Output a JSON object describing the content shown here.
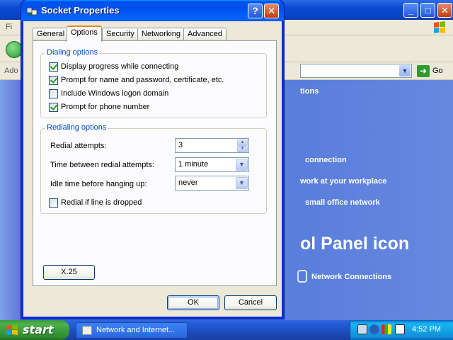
{
  "background_window": {
    "menu_partial": "Fi",
    "address_label_partial": "Ado",
    "go_label": "Go",
    "content": {
      "line1": "tions",
      "line2": "connection",
      "line3": "work at your workplace",
      "line4": "small office network",
      "heading": "ol Panel icon",
      "line6": "Network Connections"
    }
  },
  "dialog": {
    "title": "Socket Properties",
    "help_glyph": "?",
    "close_glyph": "✕",
    "tabs": [
      {
        "label": "General",
        "active": false
      },
      {
        "label": "Options",
        "active": true
      },
      {
        "label": "Security",
        "active": false
      },
      {
        "label": "Networking",
        "active": false
      },
      {
        "label": "Advanced",
        "active": false
      }
    ],
    "dialing_options": {
      "title": "Dialing options",
      "items": [
        {
          "label": "Display progress while connecting",
          "checked": true
        },
        {
          "label": "Prompt for name and password, certificate, etc.",
          "checked": true
        },
        {
          "label": "Include Windows logon domain",
          "checked": false
        },
        {
          "label": "Prompt for phone number",
          "checked": true
        }
      ]
    },
    "redialing_options": {
      "title": "Redialing options",
      "redial_attempts_label": "Redial attempts:",
      "redial_attempts_value": "3",
      "time_between_label": "Time between redial attempts:",
      "time_between_value": "1 minute",
      "idle_time_label": "Idle time before hanging up:",
      "idle_time_value": "never",
      "redial_if_dropped_label": "Redial if line is dropped",
      "redial_if_dropped_checked": false
    },
    "x25_button": "X.25",
    "ok_button": "OK",
    "cancel_button": "Cancel"
  },
  "taskbar": {
    "start_label": "start",
    "task_item": "Network and Internet...",
    "clock": "4:52 PM"
  },
  "colors": {
    "title_blue": "#0053ee",
    "group_title": "#0046d5",
    "check_green": "#21a121",
    "start_green": "#3c9a3c"
  }
}
